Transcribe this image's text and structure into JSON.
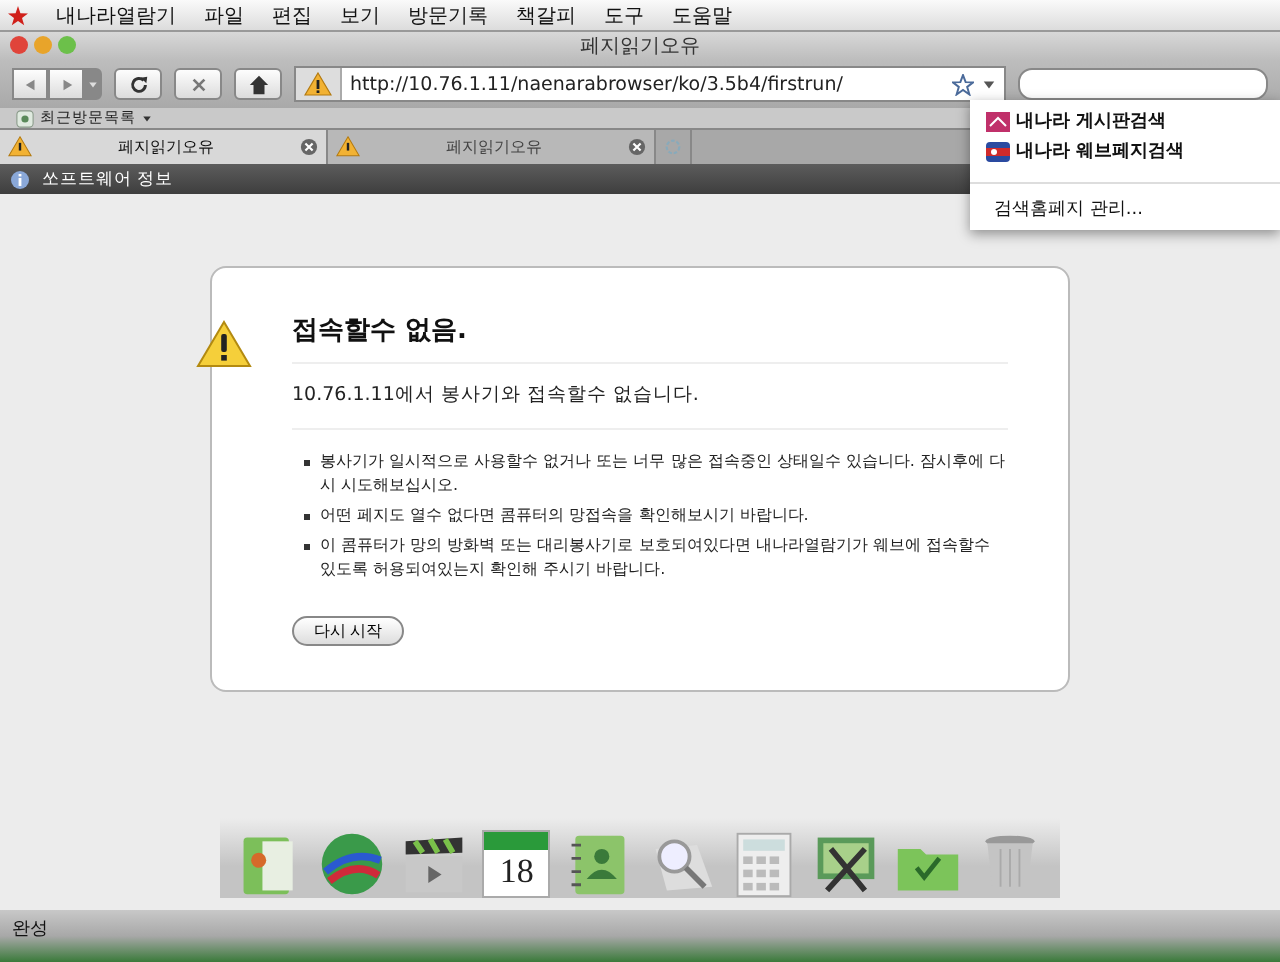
{
  "menubar": {
    "app": "내나라열람기",
    "items": [
      "파일",
      "편집",
      "보기",
      "방문기록",
      "책갈피",
      "도구",
      "도움말"
    ]
  },
  "window": {
    "title": "페지읽기오유"
  },
  "toolbar": {
    "url": "http://10.76.1.11/naenarabrowser/ko/3.5b4/firstrun/"
  },
  "bookmarks": {
    "label": "최근방문목록"
  },
  "tabs": [
    {
      "label": "페지읽기오유",
      "selected": true,
      "kind": "warning"
    },
    {
      "label": "페지읽기오유",
      "selected": false,
      "kind": "warning"
    },
    {
      "selected": false,
      "kind": "loading"
    }
  ],
  "infobar": {
    "label": "쏘프트웨어 정보"
  },
  "error": {
    "title": "접속할수 없음.",
    "subtitle": "10.76.1.11에서 봉사기와 접속할수 없습니다.",
    "bullets": [
      "봉사기가 일시적으로 사용할수 없거나 또는 너무 많은 접속중인 상태일수 있습니다. 잠시후에 다시 시도해보십시오.",
      "어떤 페지도 열수 없다면 콤퓨터의 망접속을 확인해보시기 바랍니다.",
      "이 콤퓨터가 망의 방화벽 또는 대리봉사기로 보호되여있다면 내나라열람기가 웨브에 접속할수 있도록 허용되여있는지 확인해 주시기 바랍니다."
    ],
    "button": "다시 시작"
  },
  "search_menu": {
    "items": [
      {
        "label": "내나라 게시판검색",
        "kind": "board"
      },
      {
        "label": "내나라 웨브페지검색",
        "kind": "web"
      },
      {
        "label": "검색홈페지 관리...",
        "kind": "action"
      }
    ]
  },
  "dock": {
    "items": [
      {
        "kind": "folder"
      },
      {
        "kind": "globe"
      },
      {
        "kind": "video"
      },
      {
        "kind": "calendar",
        "day": "18"
      },
      {
        "kind": "contacts"
      },
      {
        "kind": "search"
      },
      {
        "kind": "calculator"
      },
      {
        "kind": "tools"
      },
      {
        "kind": "folder2"
      },
      {
        "kind": "trash"
      }
    ]
  },
  "status": {
    "text": "완성"
  }
}
